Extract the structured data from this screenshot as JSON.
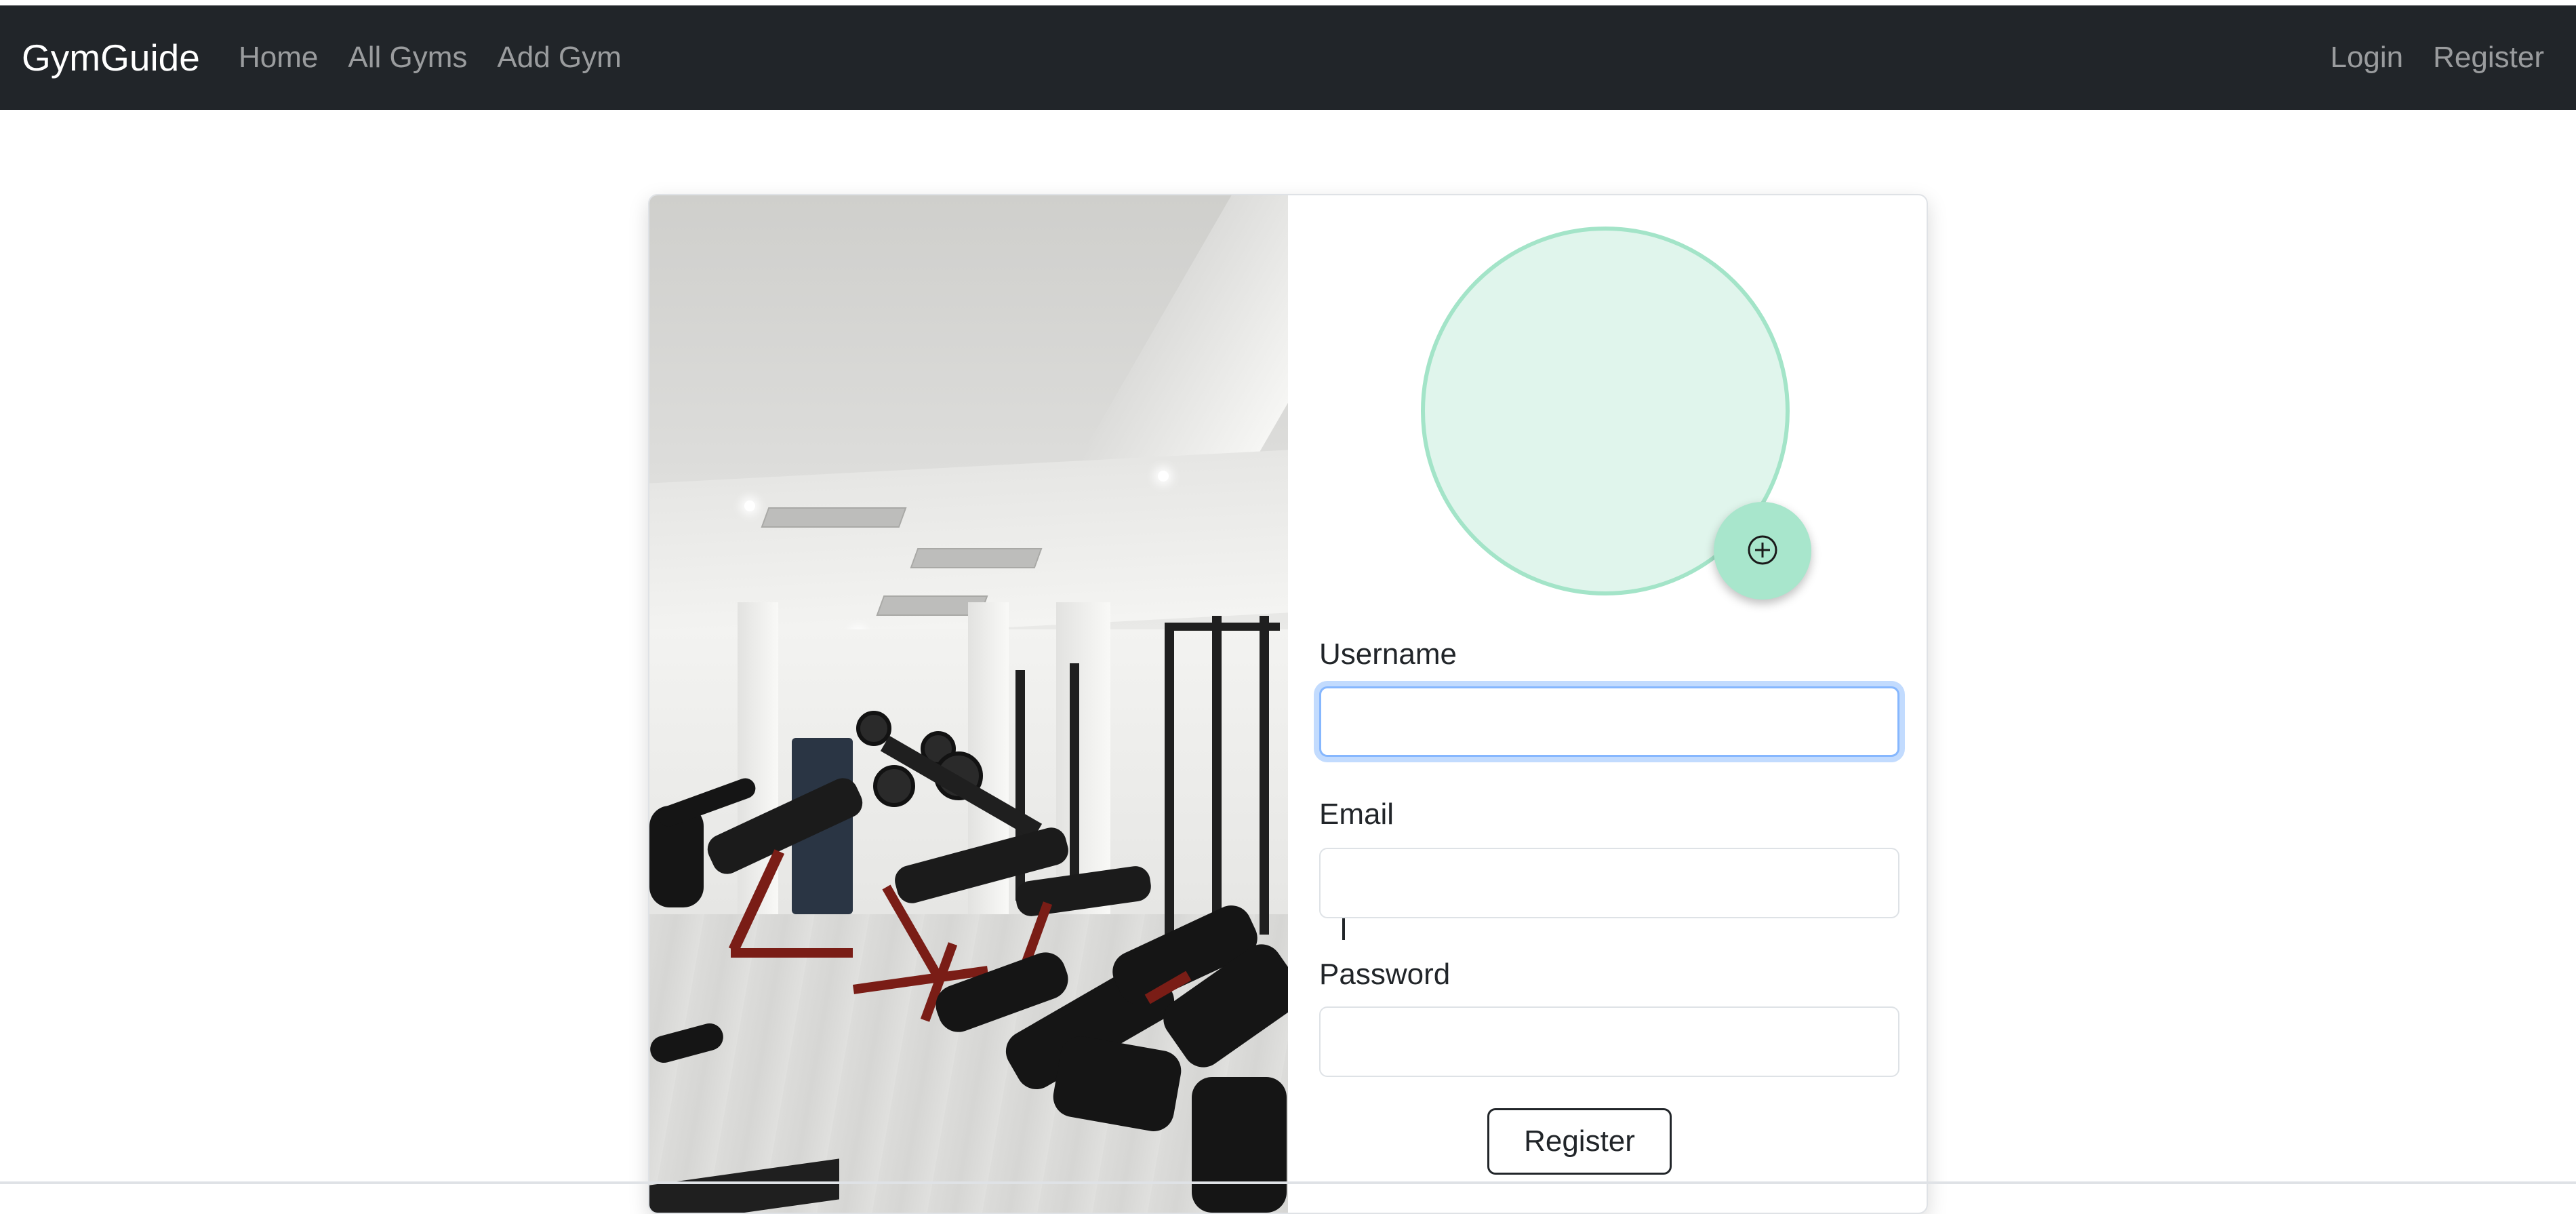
{
  "navbar": {
    "brand": "GymGuide",
    "left_links": [
      "Home",
      "All Gyms",
      "Add Gym"
    ],
    "right_links": [
      "Login",
      "Register"
    ],
    "background_color": "#212529"
  },
  "register_card": {
    "image_alt": "gym interior with benches and exercise bikes",
    "avatar": {
      "add_icon": "plus-circle-icon",
      "circle_color": "#e0f5ec",
      "button_color": "#a8e6cc"
    },
    "fields": {
      "username": {
        "label": "Username",
        "value": "",
        "focused": true
      },
      "email": {
        "label": "Email",
        "value": ""
      },
      "password": {
        "label": "Password",
        "value": ""
      }
    },
    "submit_label": "Register"
  }
}
